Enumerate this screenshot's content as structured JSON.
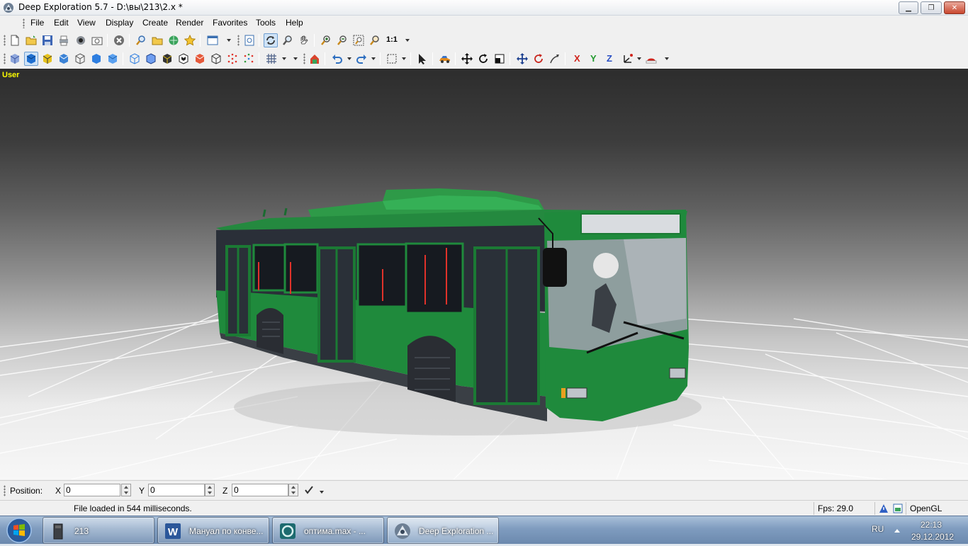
{
  "window": {
    "title": "Deep Exploration 5.7 - D:\\вы\\213\\2.x *",
    "controls": [
      "minimize",
      "maximize",
      "close"
    ]
  },
  "menu": [
    "File",
    "Edit",
    "View",
    "Display",
    "Create",
    "Render",
    "Favorites",
    "Tools",
    "Help"
  ],
  "toolbar1": {
    "zoom_ratio_label": "1:1",
    "icons": [
      "new-file-icon",
      "open-folder-icon",
      "save-icon",
      "print-icon",
      "scan-icon",
      "camera-icon",
      "stop-icon",
      "find-icon",
      "browse-icon",
      "refresh-web-icon",
      "favorites-star-icon",
      "window-icon",
      "preview-icon",
      "orbit-icon",
      "zoom-icon",
      "pan-hand-icon",
      "zoom-in-icon",
      "zoom-out-icon",
      "zoom-extents-icon",
      "zoom-window-icon"
    ]
  },
  "toolbar2": {
    "axis_x": "X",
    "axis_y": "Y",
    "axis_z": "Z",
    "icons": [
      "cube-shaded-icon",
      "cube-solid-icon",
      "cube-textured-icon",
      "cube-flat-icon",
      "cube-wireframe-icon",
      "cube-blue-icon",
      "cube-smooth-icon",
      "cube-hidden-line-icon",
      "cube-edges-icon",
      "cube-black-icon",
      "cube-checker-icon",
      "cube-red-icon",
      "cube-outline-icon",
      "points-red-icon",
      "points-multi-icon",
      "grid-icon",
      "render-icon",
      "undo-icon",
      "redo-icon",
      "selection-icon",
      "pointer-icon",
      "car-icon",
      "move-icon",
      "rotate-icon",
      "scale-icon",
      "translate-icon",
      "rotate-red-icon",
      "arrow-curve-icon",
      "axis-icon",
      "hat-icon"
    ]
  },
  "viewport": {
    "label": "User",
    "label_color": "#ffff00"
  },
  "position_bar": {
    "label": "Position:",
    "x_label": "X",
    "x_value": "0",
    "y_label": "Y",
    "y_value": "0",
    "z_label": "Z",
    "z_value": "0"
  },
  "status": {
    "message": "File loaded in 544 milliseconds.",
    "fps": "Fps: 29.0",
    "renderer": "OpenGL"
  },
  "taskbar": {
    "tasks": [
      {
        "label": "213",
        "icon": "folder-icon"
      },
      {
        "label": "Мануал по конве...",
        "icon": "word-icon"
      },
      {
        "label": "оптима.max     - ...",
        "icon": "3dsmax-icon"
      },
      {
        "label": "Deep Exploration ...",
        "icon": "deep-exploration-icon"
      }
    ],
    "language": "RU",
    "time": "22:13",
    "date": "29.12.2012"
  },
  "colors": {
    "bus_green": "#1f8a3c",
    "label_yellow": "#ffff00",
    "taskbar_blue": "#7f9cbf"
  }
}
